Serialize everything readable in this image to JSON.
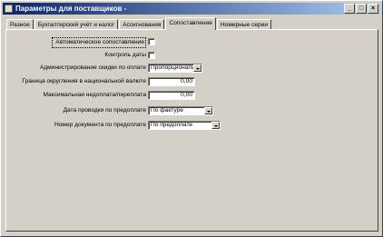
{
  "window": {
    "title": "Параметры для поставщиков -",
    "controls": [
      "_",
      "□",
      "×"
    ]
  },
  "tabs": [
    {
      "label": "Разное"
    },
    {
      "label": "Бухгалтерский учёт и налог"
    },
    {
      "label": "Ассигнования"
    },
    {
      "label": "Сопоставление",
      "active": true
    },
    {
      "label": "Номерные серии"
    }
  ],
  "form": {
    "auto_match_label": "Автоматическое сопоставление",
    "auto_match_checked": false,
    "date_control_label": "Контроль даты",
    "date_control_checked": false,
    "admin_discount_label": "Администрирование скидки по оплате",
    "admin_discount_value": "Пропорционально",
    "penny_limit_label": "Граница округления в национальной валюте",
    "penny_limit_value": "0,00",
    "max_overunder_label": "Максимальная недоплата/переплата",
    "max_overunder_value": "0,00",
    "prepay_posting_date_label": "Дата проводки по предоплате",
    "prepay_posting_date_value": "По фактуре",
    "prepay_doc_number_label": "Номер документа по предоплате",
    "prepay_doc_number_value": "По предоплате"
  }
}
